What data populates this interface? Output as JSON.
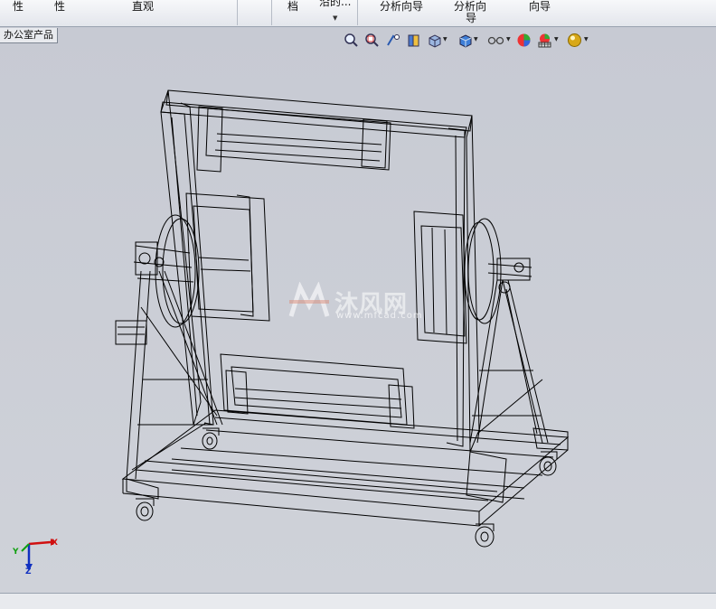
{
  "ribbon": {
    "items": [
      "性",
      "性",
      "直观",
      "档",
      "沿的...",
      "分析向导",
      "分析向",
      "导",
      "向导"
    ]
  },
  "document_tab": "办公室产品",
  "view_toolbar": {
    "icons": [
      "zoom-to-fit-icon",
      "zoom-to-area-icon",
      "previous-view-icon",
      "section-view-icon",
      "view-orientation-icon",
      "display-style-icon",
      "hide-show-items-icon",
      "edit-appearance-icon",
      "apply-scene-icon",
      "view-settings-icon"
    ]
  },
  "watermark": {
    "text": "沐风网",
    "url": "www.mfcad.com"
  },
  "triad": {
    "x": "X",
    "y": "Y",
    "z": "Z"
  },
  "colors": {
    "viewport": "#c9ccd3",
    "lines": "#000000",
    "axis_x": "#d01010",
    "axis_y": "#10a010",
    "axis_z": "#1030c0"
  }
}
